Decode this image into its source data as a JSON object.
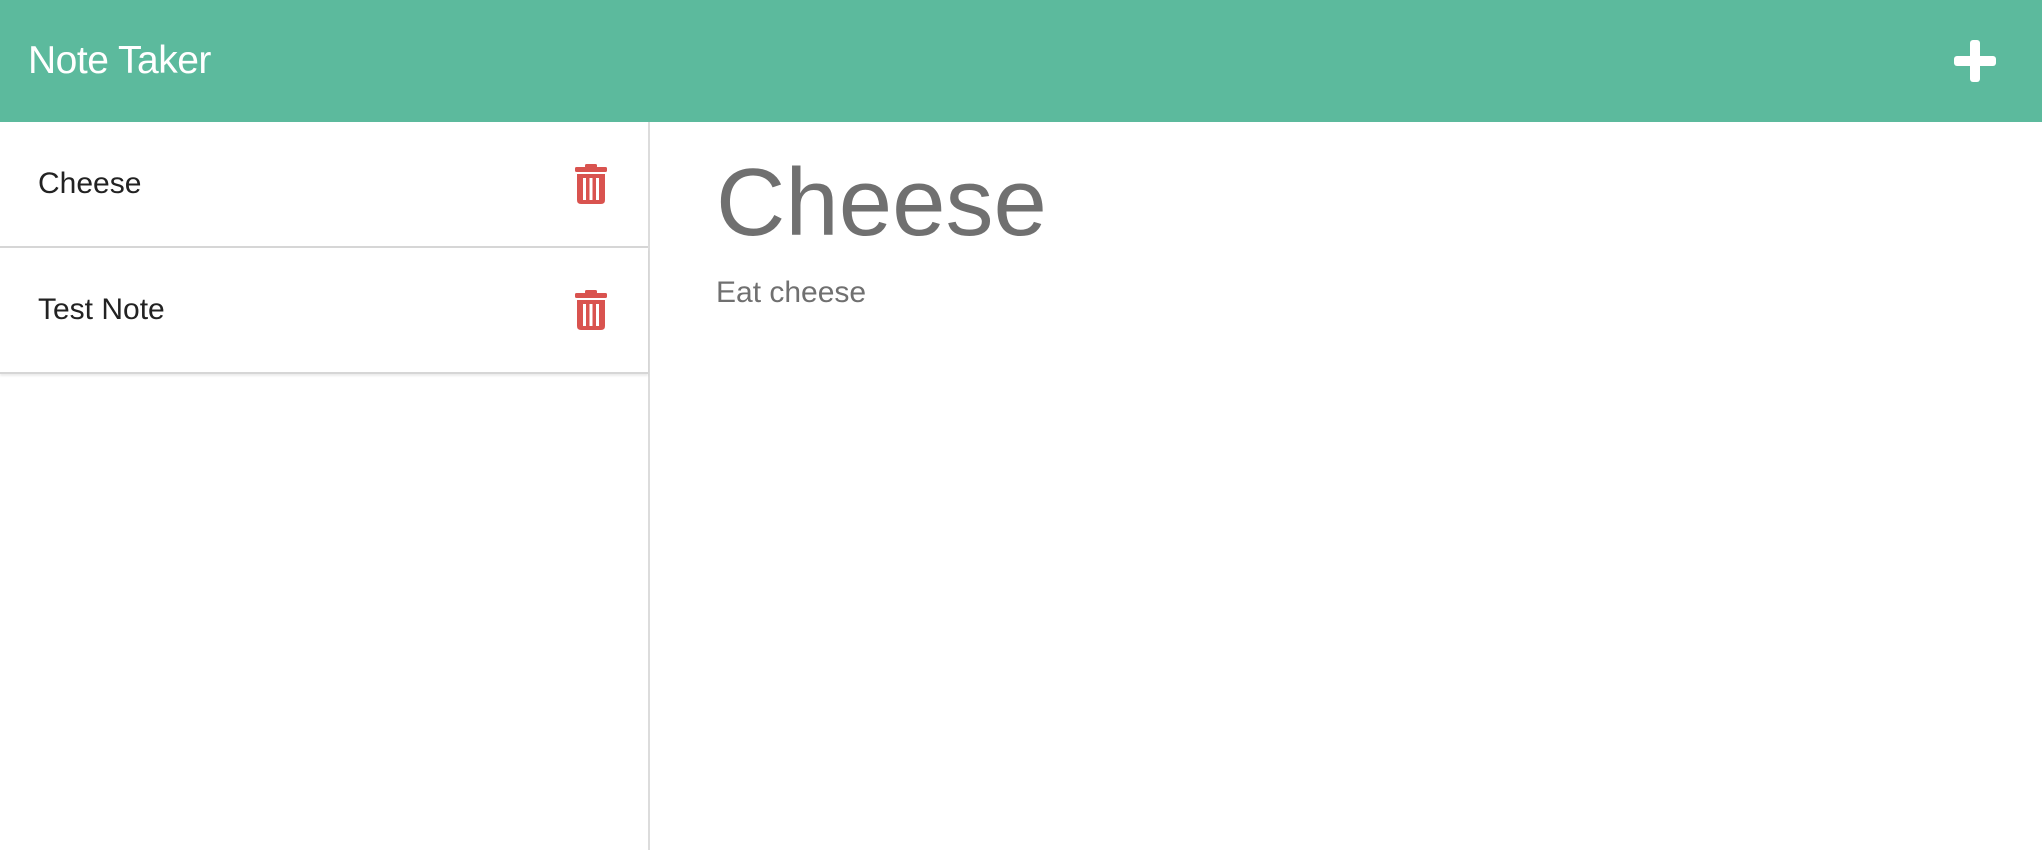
{
  "theme": {
    "navbar_bg": "#5cba9d",
    "delete_color": "#d9534f",
    "text_muted": "#707070"
  },
  "header": {
    "brand": "Note Taker",
    "new_note_icon": "plus-icon"
  },
  "sidebar": {
    "notes": [
      {
        "title": "Cheese",
        "delete_icon": "trash-icon"
      },
      {
        "title": "Test Note",
        "delete_icon": "trash-icon"
      }
    ]
  },
  "editor": {
    "title": "Cheese",
    "text": "Eat cheese"
  }
}
